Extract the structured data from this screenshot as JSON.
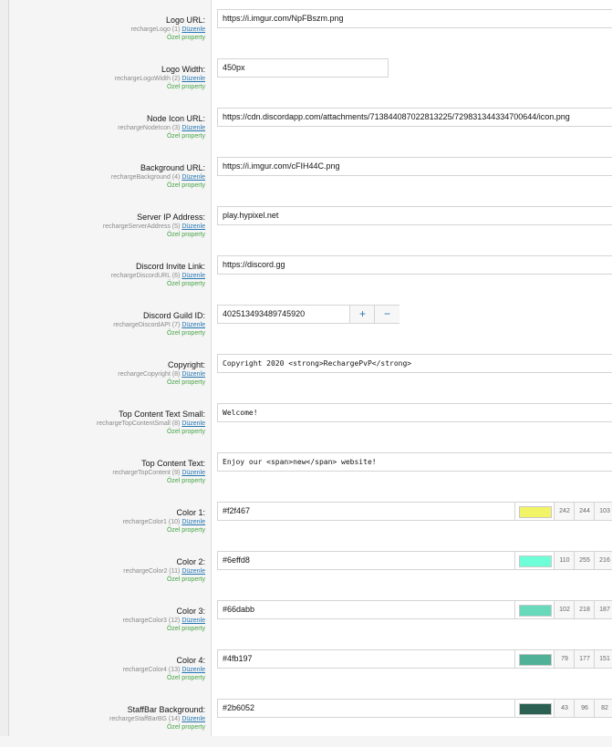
{
  "meta_edit": "Düzenle",
  "custom_text": "Özel property",
  "fields": [
    {
      "label": "Logo URL:",
      "meta": "rechargeLogo (1)",
      "value": "https://i.imgur.com/NpFBszm.png"
    },
    {
      "label": "Logo Width:",
      "meta": "rechargeLogoWidth (2)",
      "value": "450px"
    },
    {
      "label": "Node Icon URL:",
      "meta": "rechargeNodeIcon (3)",
      "value": "https://cdn.discordapp.com/attachments/713844087022813225/729831344334700644/icon.png"
    },
    {
      "label": "Background URL:",
      "meta": "rechargeBackground (4)",
      "value": "https://i.imgur.com/cFIH44C.png"
    },
    {
      "label": "Server IP Address:",
      "meta": "rechargeServerAddress (5)",
      "value": "play.hypixel.net"
    },
    {
      "label": "Discord Invite Link:",
      "meta": "rechargeDiscordURL (6)",
      "value": "https://discord.gg"
    },
    {
      "label": "Discord Guild ID:",
      "meta": "rechargeDiscordAPI (7)",
      "value": "402513493489745920",
      "plus": "+",
      "minus": "−"
    },
    {
      "label": "Copyright:",
      "meta": "rechargeCopyright (8)",
      "value": "Copyright 2020 <strong>RechargePvP</strong>"
    },
    {
      "label": "Top Content Text Small:",
      "meta": "rechargeTopContentSmall (8)",
      "value": "Welcome!"
    },
    {
      "label": "Top Content Text:",
      "meta": "rechargeTopContent (9)",
      "value": "Enjoy our <span>new</span> website!"
    }
  ],
  "colors": [
    {
      "label": "Color 1:",
      "meta": "rechargeColor1 (10)",
      "hex": "#f2f467",
      "swatch": "#f2f467",
      "r": "242",
      "g": "244",
      "b": "103"
    },
    {
      "label": "Color 2:",
      "meta": "rechargeColor2 (11)",
      "hex": "#6effd8",
      "swatch": "#6effd8",
      "r": "110",
      "g": "255",
      "b": "216"
    },
    {
      "label": "Color 3:",
      "meta": "rechargeColor3 (12)",
      "hex": "#66dabb",
      "swatch": "#66dabb",
      "r": "102",
      "g": "218",
      "b": "187"
    },
    {
      "label": "Color 4:",
      "meta": "rechargeColor4 (13)",
      "hex": "#4fb197",
      "swatch": "#4fb197",
      "r": "79",
      "g": "177",
      "b": "151"
    },
    {
      "label": "StaffBar Background:",
      "meta": "rechargeStaffBarBG (14)",
      "hex": "#2b6052",
      "swatch": "#2b6052",
      "r": "43",
      "g": "96",
      "b": "82"
    }
  ]
}
